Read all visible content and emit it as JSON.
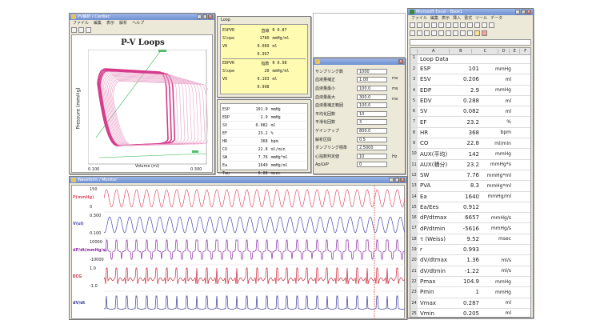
{
  "pv_window": {
    "title": "PV解析 / Cardiac",
    "menu": [
      "ファイル",
      "編集",
      "表示",
      "解析",
      "ヘルプ"
    ],
    "chart_title": "P-V Loops",
    "ylabel": "Pressure (mmHg)",
    "xlabel": "Volume (ml)",
    "x_tick_left": "0.100",
    "x_tick_right": "0.300"
  },
  "info_panel": {
    "title": "Loop",
    "rows": [
      {
        "k": "ESPVR",
        "v": "直線",
        "u": "R 0.87"
      },
      {
        "k": "Slope",
        "v": "1780",
        "u": "mmHg/ml"
      },
      {
        "k": "V0",
        "v": "0.089",
        "u": "ml"
      },
      {
        "k": "",
        "v": "0.997",
        "u": ""
      },
      {
        "k": "EDPVR",
        "v": "指数",
        "u": "R 0.98"
      },
      {
        "k": "Slope",
        "v": "20",
        "u": "mmHg/ml"
      },
      {
        "k": "V0",
        "v": "0.103",
        "u": "ml"
      },
      {
        "k": "",
        "v": "0.998",
        "u": ""
      }
    ]
  },
  "params_panel": {
    "rows": [
      {
        "k": "ESP",
        "v": "101.0",
        "u": "mmHg"
      },
      {
        "k": "EDP",
        "v": "2.9",
        "u": "mmHg"
      },
      {
        "k": "SV",
        "v": "0.082",
        "u": "ml"
      },
      {
        "k": "EF",
        "v": "23.2",
        "u": "%"
      },
      {
        "k": "HR",
        "v": "368",
        "u": "bpm"
      },
      {
        "k": "CO",
        "v": "22.8",
        "u": "ml/min"
      },
      {
        "k": "SW",
        "v": "7.76",
        "u": "mmHg*ml"
      },
      {
        "k": "Ea",
        "v": "1640",
        "u": "mmHg/ml"
      },
      {
        "k": "Tau",
        "v": "6.88",
        "u": "msec"
      }
    ]
  },
  "settings_panel": {
    "rows": [
      {
        "label": "サンプリング数",
        "value": "1000"
      },
      {
        "label": "血液量補正",
        "value": "1.00"
      },
      {
        "label": "血液量最小",
        "value": "100.0"
      },
      {
        "label": "血液量最大",
        "value": "300.0"
      },
      {
        "label": "血液量補正範囲",
        "value": "100.0"
      },
      {
        "label": "平均化回数",
        "value": "10"
      },
      {
        "label": "平滑化回数",
        "value": "3"
      },
      {
        "label": "ゲインアップ",
        "value": "800.0"
      },
      {
        "label": "解析区間",
        "value": "0.5"
      },
      {
        "label": "ダンプリング標準",
        "value": "2.5000"
      },
      {
        "label": "心拍数判定値",
        "value": "10"
      },
      {
        "label": "Ap/LVP",
        "value": "0"
      }
    ],
    "side_labels": [
      "ms",
      "ms",
      "ms",
      "Hz"
    ]
  },
  "waveform_window": {
    "title": "Waveform / Monitor",
    "channels": [
      {
        "label": "P(mmHg)",
        "top": "150",
        "bottom": "0",
        "color": "#e0556a"
      },
      {
        "label": "V(ul)",
        "top": "0.300",
        "bottom": "0.100",
        "color": "#4a4ab0"
      },
      {
        "label": "dP/dt(mmHg/s)",
        "top": "10000",
        "bottom": "-10000",
        "color": "#8a2fa0"
      },
      {
        "label": "ECG",
        "top": "1.0",
        "bottom": "-1.0",
        "color": "#c8283c"
      },
      {
        "label": "dV/dt",
        "top": "",
        "bottom": "",
        "color": "#3a3a9a"
      }
    ]
  },
  "excel_window": {
    "title": "Microsoft Excel - Book1",
    "menu": [
      "ファイル",
      "編集",
      "表示",
      "挿入",
      "書式",
      "ツール",
      "データ"
    ],
    "col_headers": [
      "A",
      "B",
      "C",
      "D",
      "E",
      "F"
    ],
    "header_row": "Loop Data",
    "rows": [
      {
        "n": "2",
        "name": "ESP",
        "value": "101",
        "unit": "mmHg"
      },
      {
        "n": "3",
        "name": "ESV",
        "value": "0.206",
        "unit": "ml"
      },
      {
        "n": "4",
        "name": "EDP",
        "value": "2.9",
        "unit": "mmHg"
      },
      {
        "n": "5",
        "name": "EDV",
        "value": "0.288",
        "unit": "ml"
      },
      {
        "n": "6",
        "name": "SV",
        "value": "0.082",
        "unit": "ml"
      },
      {
        "n": "7",
        "name": "EF",
        "value": "23.2",
        "unit": "%"
      },
      {
        "n": "8",
        "name": "HR",
        "value": "368",
        "unit": "bpm"
      },
      {
        "n": "9",
        "name": "CO",
        "value": "22.8",
        "unit": "ml/min"
      },
      {
        "n": "10",
        "name": "AUX(平均)",
        "value": "142",
        "unit": "mmHg"
      },
      {
        "n": "11",
        "name": "AUX(積分)",
        "value": "23.2",
        "unit": "mmHg*s"
      },
      {
        "n": "12",
        "name": "SW",
        "value": "7.76",
        "unit": "mmHg*ml"
      },
      {
        "n": "13",
        "name": "PVA",
        "value": "8.3",
        "unit": "mmHg*ml"
      },
      {
        "n": "14",
        "name": "Ea",
        "value": "1640",
        "unit": "mmHg/ml"
      },
      {
        "n": "15",
        "name": "Ea/Ees",
        "value": "0.912",
        "unit": ""
      },
      {
        "n": "16",
        "name": "dP/dtmax",
        "value": "6657",
        "unit": "mmHg/s"
      },
      {
        "n": "17",
        "name": "dP/dtmin",
        "value": "-5616",
        "unit": "mmHg/s"
      },
      {
        "n": "18",
        "name": "τ (Weiss)",
        "value": "9.52",
        "unit": "msec"
      },
      {
        "n": "19",
        "name": "r",
        "value": "0.993",
        "unit": ""
      },
      {
        "n": "20",
        "name": "dV/dtmax",
        "value": "1.36",
        "unit": "ml/s"
      },
      {
        "n": "21",
        "name": "dV/dtmin",
        "value": "-1.22",
        "unit": "ml/s"
      },
      {
        "n": "22",
        "name": "Pmax",
        "value": "104.9",
        "unit": "mmHg"
      },
      {
        "n": "23",
        "name": "Pmin",
        "value": "1",
        "unit": "mmHg"
      },
      {
        "n": "24",
        "name": "Vmax",
        "value": "0.287",
        "unit": "ml"
      },
      {
        "n": "25",
        "name": "Vmin",
        "value": "0.205",
        "unit": "ml"
      }
    ]
  },
  "colors": {
    "loop": "#d63a8a",
    "loop_light": "#e9a3c9",
    "espvr": "#4fbf6a",
    "cursor": "#e05a5a"
  }
}
